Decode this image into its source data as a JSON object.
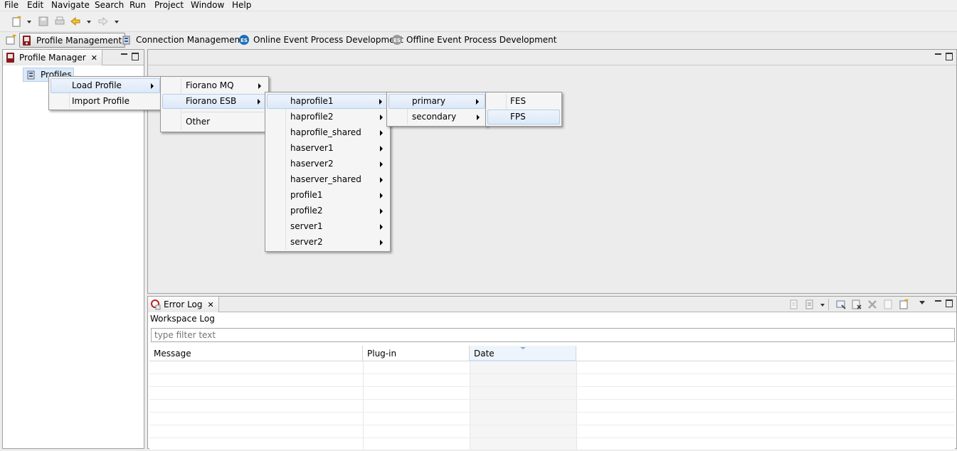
{
  "menubar": {
    "items": [
      "File",
      "Edit",
      "Navigate",
      "Search",
      "Run",
      "Project",
      "Window",
      "Help"
    ]
  },
  "perspectives": [
    {
      "label": "Profile Management",
      "icon": "profile-management-icon",
      "active": true
    },
    {
      "label": "Connection Management",
      "icon": "connection-management-icon"
    },
    {
      "label": "Online Event Process Development",
      "icon": "online-eventprocess-icon"
    },
    {
      "label": "Offline Event Process Development",
      "icon": "offline-eventprocess-icon"
    }
  ],
  "profile_manager": {
    "tab_label": "Profile Manager",
    "tree_root": "Profiles"
  },
  "context_menu": {
    "items": [
      "Load Profile",
      "Import Profile"
    ]
  },
  "load_profile_menu": {
    "items": [
      "Fiorano MQ",
      "Fiorano ESB",
      "Other"
    ]
  },
  "esb_menu": {
    "items": [
      "haprofile1",
      "haprofile2",
      "haprofile_shared",
      "haserver1",
      "haserver2",
      "haserver_shared",
      "profile1",
      "profile2",
      "server1",
      "server2"
    ]
  },
  "haprofile_menu": {
    "items": [
      "primary",
      "secondary"
    ]
  },
  "primary_menu": {
    "items": [
      "FES",
      "FPS"
    ]
  },
  "error_log": {
    "tab_label": "Error Log",
    "subtitle": "Workspace Log",
    "filter_placeholder": "type filter text",
    "columns": [
      "Message",
      "Plug-in",
      "Date"
    ]
  },
  "colors": {
    "highlight_bg": "#dce9f8",
    "highlight_border": "#b5cde9",
    "accent_blue": "#1e6fb5"
  }
}
